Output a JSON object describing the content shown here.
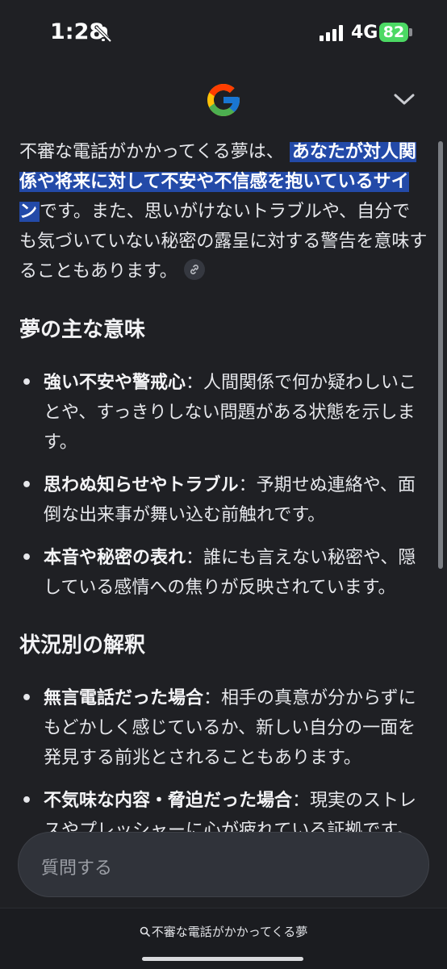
{
  "status_bar": {
    "time": "1:28",
    "network": "4G",
    "battery": "82"
  },
  "header": {
    "logo": "google-g-logo",
    "collapse_icon": "chevron-down-icon"
  },
  "answer": {
    "intro_before": "不審な電話がかかってくる夢は、",
    "intro_highlight": "あなたが対人関係や将来に対して不安や不信感を抱いているサイン",
    "intro_after": "です。また、思いがけないトラブルや、自分でも気づいていない秘密の露呈に対する警告を意味することもあります。",
    "section1_title": "夢の主な意味",
    "section1_items": [
      {
        "bold": "強い不安や警戒心",
        "text": "：人間関係で何か疑わしいことや、すっきりしない問題がある状態を示します。"
      },
      {
        "bold": "思わぬ知らせやトラブル",
        "text": "：予期せぬ連絡や、面倒な出来事が舞い込む前触れです。"
      },
      {
        "bold": "本音や秘密の表れ",
        "text": "：誰にも言えない秘密や、隠している感情への焦りが反映されています。"
      }
    ],
    "section2_title": "状況別の解釈",
    "section2_items": [
      {
        "bold": "無言電話だった場合",
        "text": "：相手の真意が分からずにもどかしく感じているか、新しい自分の一面を発見する前兆とされることもあります。"
      },
      {
        "bold": "不気味な内容・脅迫だった場合",
        "text": "：現実のストレスやプレッシャーに心が疲れている証拠です。しっかり休息をとりましょう。"
      }
    ]
  },
  "ask_input": {
    "placeholder": "質問する"
  },
  "bottom": {
    "query": "不審な電話がかかってくる夢"
  },
  "colors": {
    "background": "#1f2024",
    "highlight": "#234aa8",
    "battery": "#4cd964"
  }
}
